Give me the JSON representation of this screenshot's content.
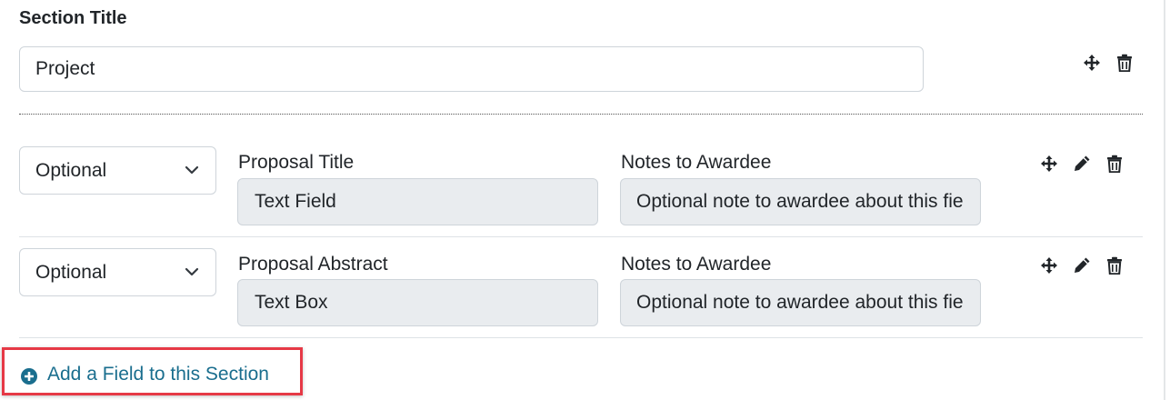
{
  "section": {
    "title_label": "Section Title",
    "title_value": "Project"
  },
  "fields": [
    {
      "requirement": "Optional",
      "name_label": "Proposal Title",
      "type_value": "Text Field",
      "notes_label": "Notes to Awardee",
      "notes_placeholder": "Optional note to awardee about this field"
    },
    {
      "requirement": "Optional",
      "name_label": "Proposal Abstract",
      "type_value": "Text Box",
      "notes_label": "Notes to Awardee",
      "notes_placeholder": "Optional note to awardee about this field"
    }
  ],
  "add_field": {
    "label": "Add a Field to this Section"
  },
  "icons": {
    "move": "move-icon",
    "edit": "pencil-icon",
    "delete": "trash-icon",
    "dropdown": "chevron-down-icon",
    "add": "plus-circle-icon"
  },
  "colors": {
    "link": "#1a6e8e",
    "highlight": "#e63946",
    "readonly_bg": "#e9ecef",
    "border": "#ced4da"
  }
}
